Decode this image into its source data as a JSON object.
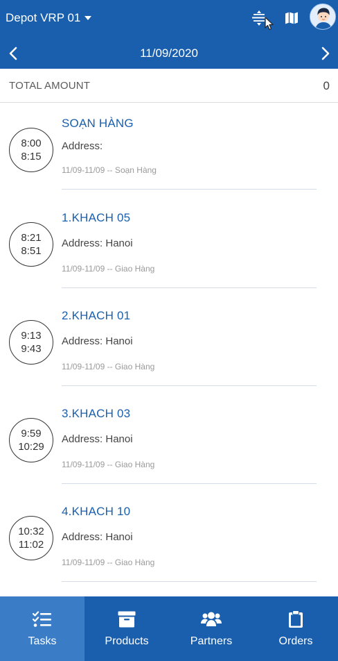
{
  "header": {
    "depot_name": "Depot VRP 01",
    "date": "11/09/2020"
  },
  "summary": {
    "total_label": "TOTAL AMOUNT",
    "total_value": "0"
  },
  "tasks": [
    {
      "start": "8:00",
      "end": "8:15",
      "title": "SOẠN HÀNG",
      "address": "Address:",
      "meta": "11/09-11/09 -- Soạn Hàng"
    },
    {
      "start": "8:21",
      "end": "8:51",
      "title": "1.KHACH 05",
      "address": "Address: Hanoi",
      "meta": "11/09-11/09 -- Giao Hàng"
    },
    {
      "start": "9:13",
      "end": "9:43",
      "title": "2.KHACH 01",
      "address": "Address: Hanoi",
      "meta": "11/09-11/09 -- Giao Hàng"
    },
    {
      "start": "9:59",
      "end": "10:29",
      "title": "3.KHACH 03",
      "address": "Address: Hanoi",
      "meta": "11/09-11/09 -- Giao Hàng"
    },
    {
      "start": "10:32",
      "end": "11:02",
      "title": "4.KHACH 10",
      "address": "Address: Hanoi",
      "meta": "11/09-11/09 -- Giao Hàng"
    }
  ],
  "bottom_nav": {
    "tabs": [
      {
        "label": "Tasks",
        "icon": "tasks-checklist-icon",
        "active": true
      },
      {
        "label": "Products",
        "icon": "archive-box-icon",
        "active": false
      },
      {
        "label": "Partners",
        "icon": "users-group-icon",
        "active": false
      },
      {
        "label": "Orders",
        "icon": "clipboard-icon",
        "active": false
      }
    ]
  },
  "colors": {
    "primary": "#1a5fad",
    "active_tab": "#3b7cc6",
    "title_text": "#1a5fad"
  }
}
